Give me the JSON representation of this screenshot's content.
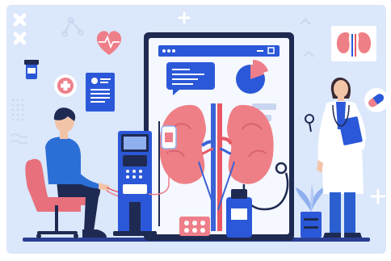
{
  "scene": {
    "description_label": "",
    "colors": {
      "background_panel": "#dbe7fb",
      "device_frame": "#1f2a52",
      "screen": "#f5f8ff",
      "kidney": "#ef7f86",
      "kidney_dark": "#d9646e",
      "artery": "#e65964",
      "vein": "#3a63d6",
      "accent_blue": "#2b58d8",
      "patient_shirt": "#2b6fd6",
      "chair": "#e7707c",
      "doctor_coat": "#ffffff",
      "doctor_pants": "#2b5fd0",
      "ground": "#2a3f93"
    },
    "icons": [
      "close-x-icon",
      "molecule-icon",
      "heart-rate-icon",
      "pill-bottle-icon",
      "medical-cross-icon",
      "medical-record-icon",
      "heart-badge-icon",
      "kidney-poster-icon",
      "capsule-icon",
      "plus-icon",
      "magnifier-icon",
      "pie-chart-icon",
      "stethoscope-icon",
      "dialysis-machine-icon",
      "iv-bag-icon"
    ]
  }
}
